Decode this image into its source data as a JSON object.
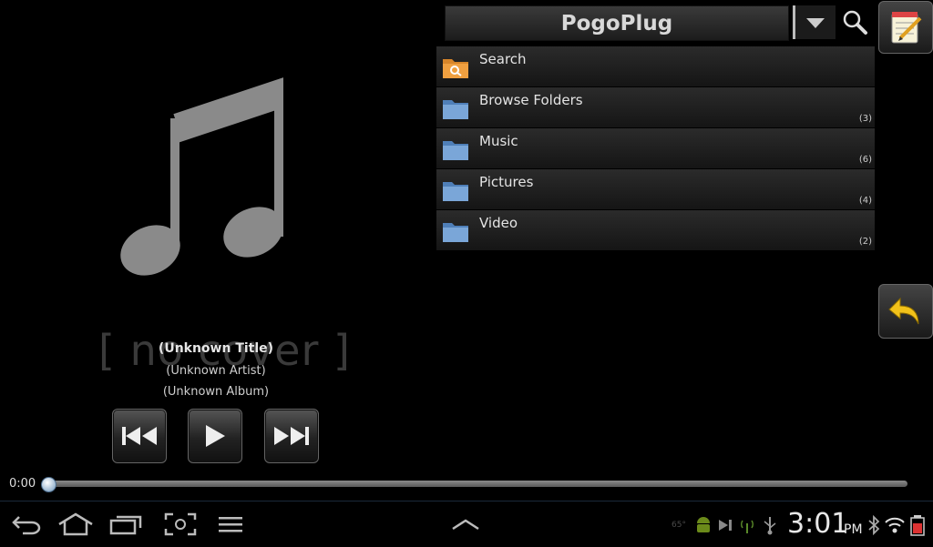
{
  "header": {
    "title": "PogoPlug"
  },
  "player": {
    "no_cover_text": "[ no cover ]",
    "title": "(Unknown Title)",
    "artist": "(Unknown Artist)",
    "album": "(Unknown Album)",
    "time": "0:00",
    "progress": 0.0
  },
  "list": {
    "items": [
      {
        "label": "Search",
        "count": "",
        "icon": "search-folder-icon"
      },
      {
        "label": "Browse Folders",
        "count": "(3)",
        "icon": "folder-icon"
      },
      {
        "label": "Music",
        "count": "(6)",
        "icon": "folder-icon"
      },
      {
        "label": "Pictures",
        "count": "(4)",
        "icon": "folder-icon"
      },
      {
        "label": "Video",
        "count": "(2)",
        "icon": "folder-icon"
      }
    ]
  },
  "status": {
    "time": "3:01",
    "ampm": "PM",
    "temperature": "65°"
  },
  "colors": {
    "folder_blue": "#7aa6d8",
    "search_folder_orange": "#f0a040",
    "arrow_yellow": "#f2c21a"
  }
}
